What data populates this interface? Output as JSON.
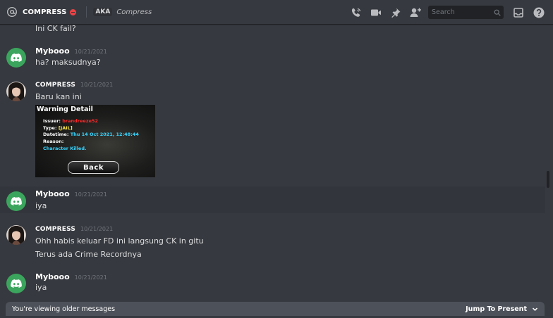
{
  "header": {
    "user_name": "COMPRESS",
    "aka_label": "AKA",
    "aka_name": "Compress",
    "search_placeholder": "Search",
    "status_color": "#ed4245",
    "icons": [
      "at-icon",
      "voice-call-icon",
      "video-call-icon",
      "pin-icon",
      "add-friend-icon",
      "search-icon",
      "inbox-icon",
      "help-icon"
    ]
  },
  "messages": [
    {
      "content": "Ini CK fail?"
    },
    {
      "author": "Mybooo",
      "timestamp": "10/21/2021",
      "content": "ha? maksudnya?"
    },
    {
      "author": "COMPRESS",
      "timestamp": "10/21/2021",
      "content": "Baru kan ini",
      "attachment": {
        "title": "Warning Detail",
        "issuer_label": "Issuer:",
        "issuer_value": "brandreeze52",
        "type_label": "Type:",
        "type_value": "[JAIL]",
        "datetime_label": "Datetime:",
        "datetime_value": "Thu 14 Oct 2021, 12:48:44",
        "reason_label": "Reason:",
        "reason_value": "Character Killed.",
        "back_button": "Back"
      }
    },
    {
      "author": "Mybooo",
      "timestamp": "10/21/2021",
      "content": "iya"
    },
    {
      "author": "COMPRESS",
      "timestamp": "10/21/2021",
      "content": "Ohh habis keluar FD ini langsung CK in gitu",
      "content2": "Terus ada Crime Recordnya"
    },
    {
      "author": "Mybooo",
      "timestamp": "10/21/2021",
      "content": "iya"
    }
  ],
  "older_bar": {
    "text": "You're viewing older messages",
    "jump_label": "Jump To Present"
  },
  "colors": {
    "background": "#36393f",
    "discord_avatar": "#3ba55d",
    "older_bar": "#4d5159"
  }
}
